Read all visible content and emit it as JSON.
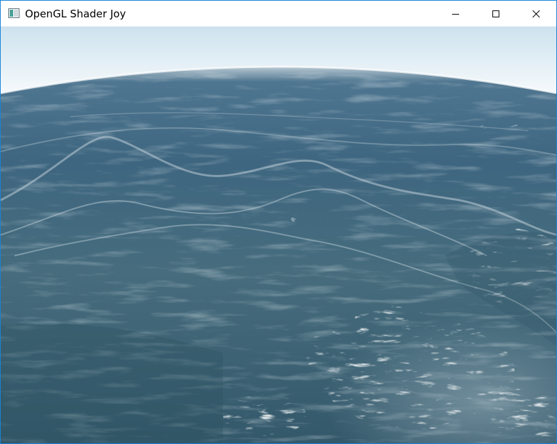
{
  "window": {
    "title": "OpenGL Shader Joy",
    "accent_border": "#1883d7"
  },
  "titlebar": {
    "icon": "app-window-icon",
    "buttons": [
      {
        "name": "minimize",
        "icon": "minimize-icon"
      },
      {
        "name": "maximize",
        "icon": "maximize-icon"
      },
      {
        "name": "close",
        "icon": "close-icon"
      }
    ]
  },
  "scene": {
    "description_icon": "ocean-render",
    "sky_top": "#cfe3ef",
    "sky_horizon": "#f7fbfd",
    "sea_far": "#3d6680",
    "sea_mid": "#42687c",
    "sea_near": "#345a68",
    "foam": "#dfe8ee"
  }
}
